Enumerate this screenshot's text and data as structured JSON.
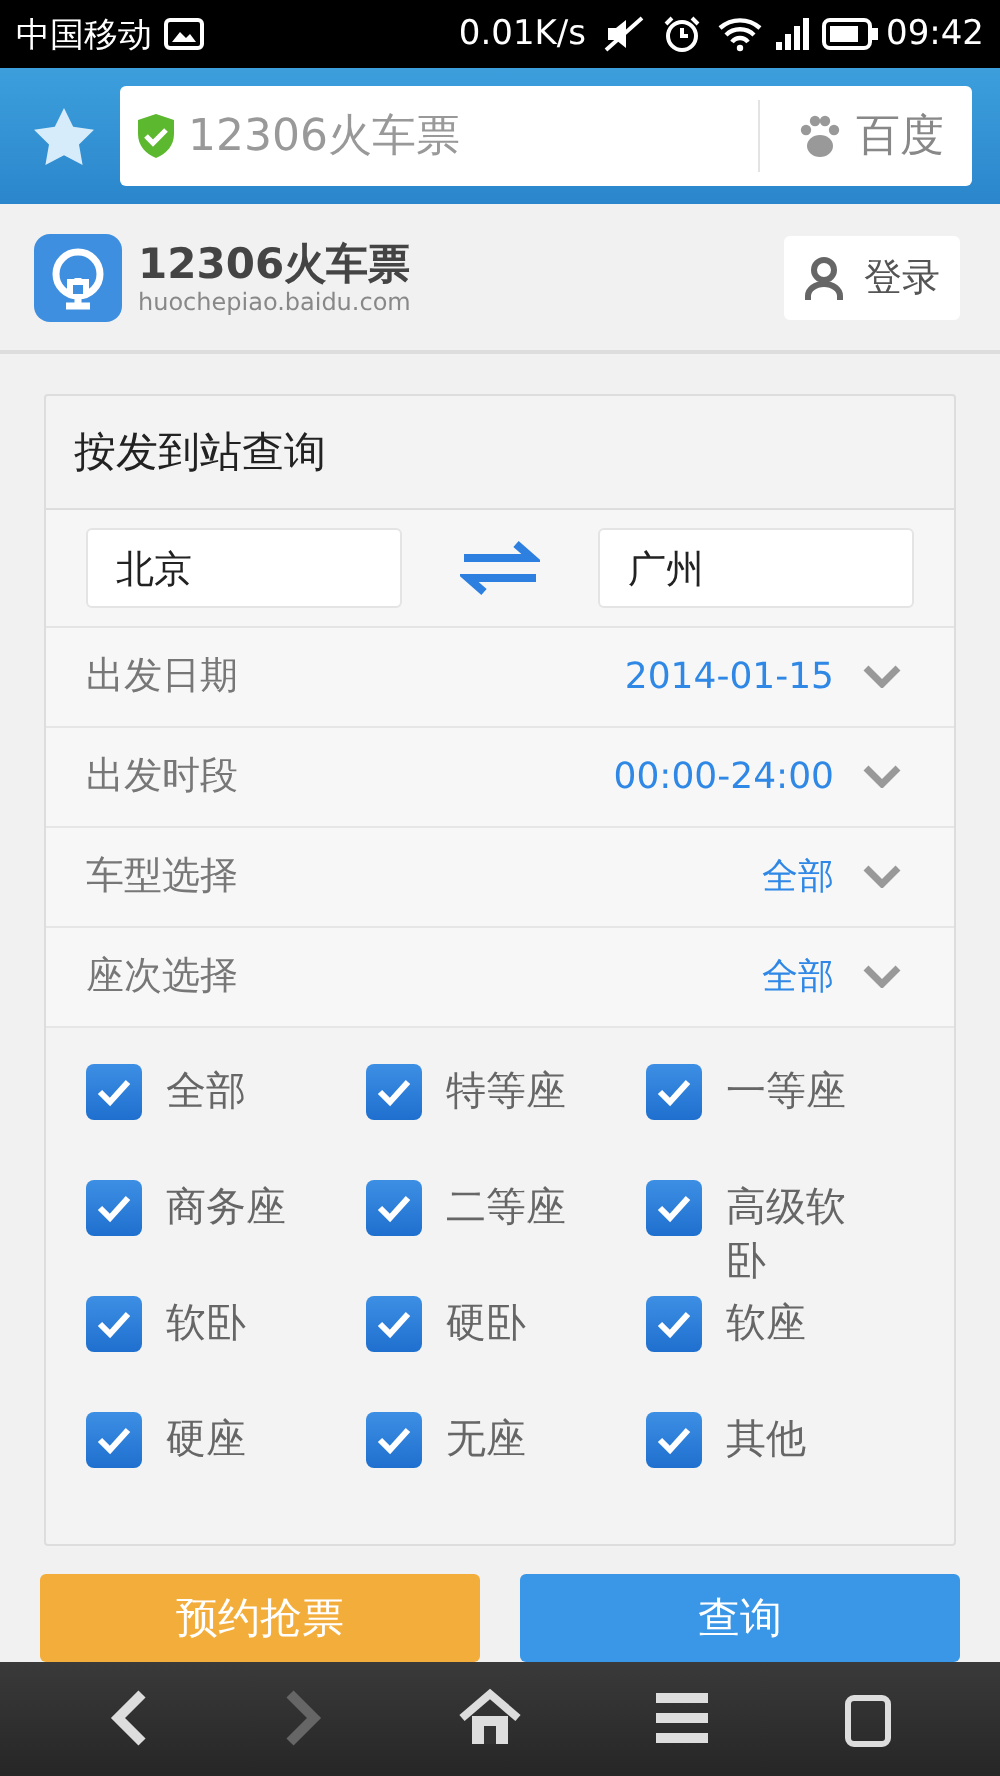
{
  "status_bar": {
    "carrier": "中国移动",
    "speed": "0.01K/s",
    "time": "09:42"
  },
  "browser_bar": {
    "url_text": "12306火车票",
    "search_engine": "百度"
  },
  "header": {
    "title": "12306火车票",
    "subtitle": "huochepiao.baidu.com",
    "login": "登录"
  },
  "form": {
    "title": "按发到站查询",
    "from": "北京",
    "to": "广州",
    "options": [
      {
        "label": "出发日期",
        "value": "2014-01-15"
      },
      {
        "label": "出发时段",
        "value": "00:00-24:00"
      },
      {
        "label": "车型选择",
        "value": "全部"
      },
      {
        "label": "座次选择",
        "value": "全部"
      }
    ],
    "seat_types": [
      {
        "label": "全部",
        "checked": true
      },
      {
        "label": "特等座",
        "checked": true
      },
      {
        "label": "一等座",
        "checked": true
      },
      {
        "label": "商务座",
        "checked": true
      },
      {
        "label": "二等座",
        "checked": true
      },
      {
        "label": "高级软卧",
        "checked": true
      },
      {
        "label": "软卧",
        "checked": true
      },
      {
        "label": "硬卧",
        "checked": true
      },
      {
        "label": "软座",
        "checked": true
      },
      {
        "label": "硬座",
        "checked": true
      },
      {
        "label": "无座",
        "checked": true
      },
      {
        "label": "其他",
        "checked": true
      }
    ]
  },
  "buttons": [
    {
      "label": "预约抢票",
      "kind": "secondary"
    },
    {
      "label": "查询",
      "kind": "primary"
    }
  ],
  "nav_bar": [
    {
      "kind": "back",
      "disabled": false
    },
    {
      "kind": "forward",
      "disabled": true
    },
    {
      "kind": "home",
      "disabled": false
    },
    {
      "kind": "menu",
      "disabled": false
    },
    {
      "kind": "tabs",
      "disabled": false
    }
  ]
}
